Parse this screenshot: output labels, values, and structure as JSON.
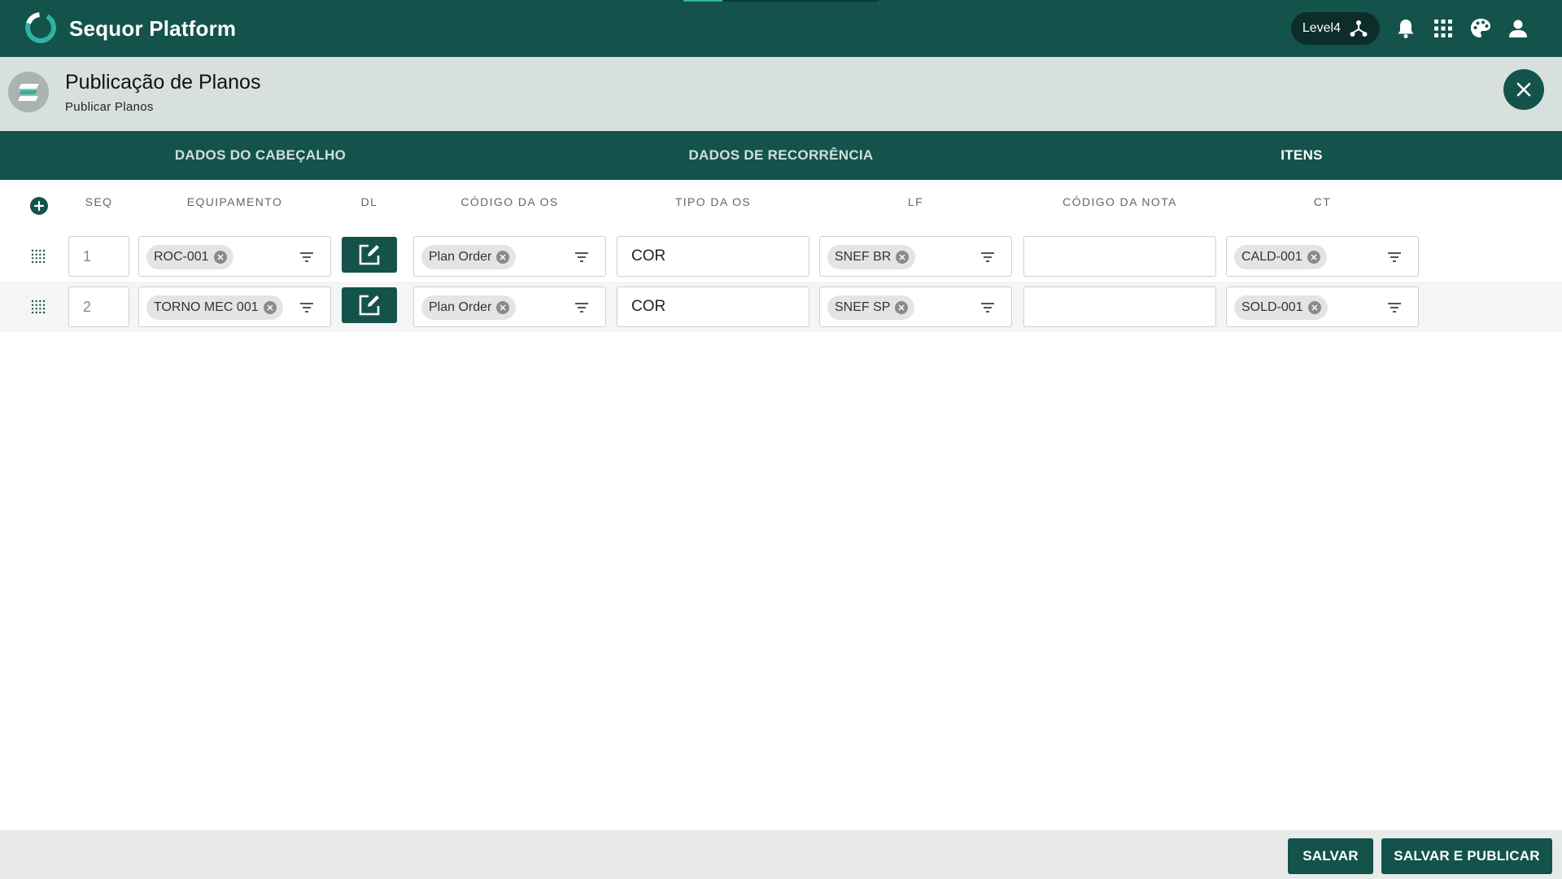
{
  "app": {
    "name": "Sequor Platform",
    "level": "Level4"
  },
  "page": {
    "title": "Publicação de Planos",
    "subtitle": "Publicar Planos"
  },
  "tabs": [
    {
      "label": "DADOS DO CABEÇALHO",
      "active": false
    },
    {
      "label": "DADOS DE RECORRÊNCIA",
      "active": false
    },
    {
      "label": "ITENS",
      "active": true
    }
  ],
  "columns": {
    "seq": "SEQ",
    "equipamento": "EQUIPAMENTO",
    "dl": "DL",
    "codigo_os": "CÓDIGO DA OS",
    "tipo_os": "TIPO DA OS",
    "lf": "LF",
    "codigo_nota": "CÓDIGO DA NOTA",
    "ct": "CT"
  },
  "rows": [
    {
      "seq": "1",
      "equipamento": "ROC-001",
      "codigo_os": "Plan Order",
      "tipo_os": "COR",
      "lf": "SNEF BR",
      "codigo_nota": "",
      "ct": "CALD-001"
    },
    {
      "seq": "2",
      "equipamento": "TORNO MEC 001",
      "codigo_os": "Plan Order",
      "tipo_os": "COR",
      "lf": "SNEF SP",
      "codigo_nota": "",
      "ct": "SOLD-001"
    }
  ],
  "footer": {
    "save_label": "SALVAR",
    "save_publish_label": "SALVAR E PUBLICAR"
  },
  "colors": {
    "primary": "#13534b",
    "header_band": "#d8e0dd",
    "accent": "#2fb3a2"
  }
}
